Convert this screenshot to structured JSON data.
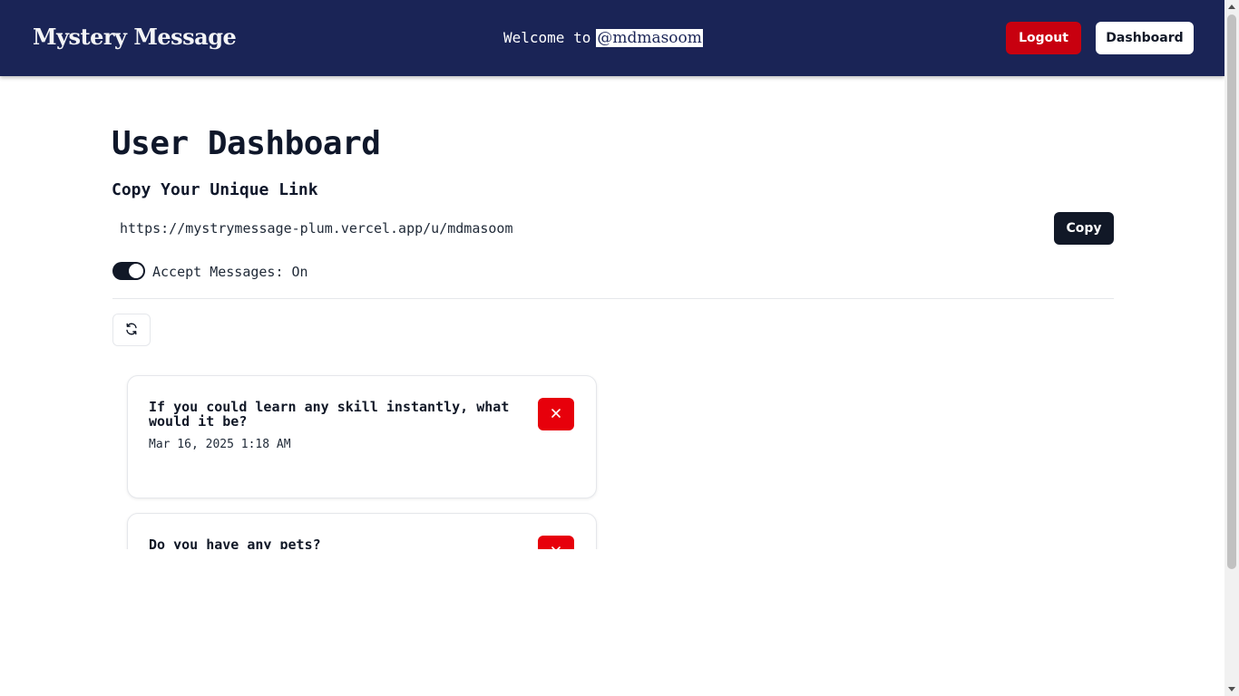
{
  "navbar": {
    "logo": "Mystery Message",
    "welcome_prefix": "Welcome to",
    "username": "@mdmasoom",
    "logout_label": "Logout",
    "dashboard_label": "Dashboard"
  },
  "main": {
    "title": "User Dashboard",
    "link_heading": "Copy Your Unique Link",
    "unique_link": "https://mystrymessage-plum.vercel.app/u/mdmasoom",
    "copy_label": "Copy",
    "accept_messages_label": "Accept Messages: On",
    "accept_messages_on": true,
    "refresh_icon": "refresh-icon"
  },
  "messages": [
    {
      "content": "If you could learn any skill instantly, what would it be?",
      "date": "Mar 16, 2025 1:18 AM"
    },
    {
      "content": "Do you have any pets?",
      "date": ""
    }
  ],
  "colors": {
    "navbar_bg": "#1a2456",
    "logout_bg": "#c8000f",
    "delete_bg": "#e7000b",
    "dark_button": "#111827"
  }
}
